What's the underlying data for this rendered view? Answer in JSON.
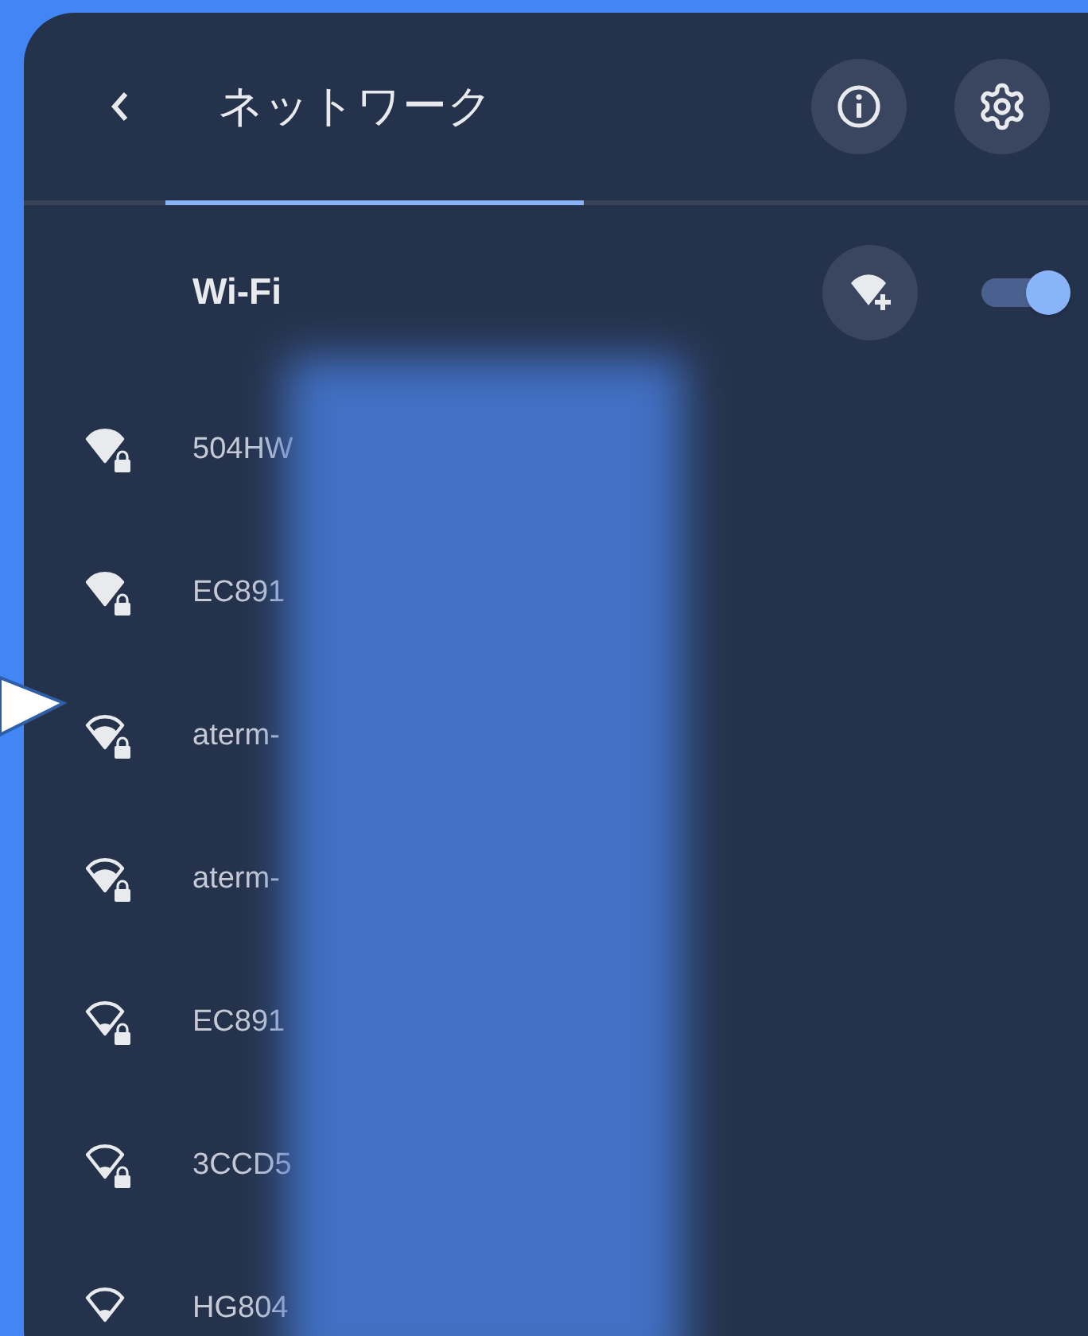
{
  "header": {
    "title": "ネットワーク"
  },
  "wifi": {
    "label": "Wi-Fi",
    "on": true
  },
  "networks": [
    {
      "name": "504HW",
      "kind": "full",
      "secured": true
    },
    {
      "name": "EC891",
      "kind": "full",
      "secured": true
    },
    {
      "name": "aterm-",
      "kind": "medium",
      "secured": true
    },
    {
      "name": "aterm-",
      "kind": "medium",
      "secured": true
    },
    {
      "name": "EC891",
      "kind": "weak",
      "secured": true
    },
    {
      "name": "3CCD5",
      "kind": "weak",
      "secured": true
    },
    {
      "name": "HG804",
      "kind": "weak",
      "secured": false
    }
  ]
}
